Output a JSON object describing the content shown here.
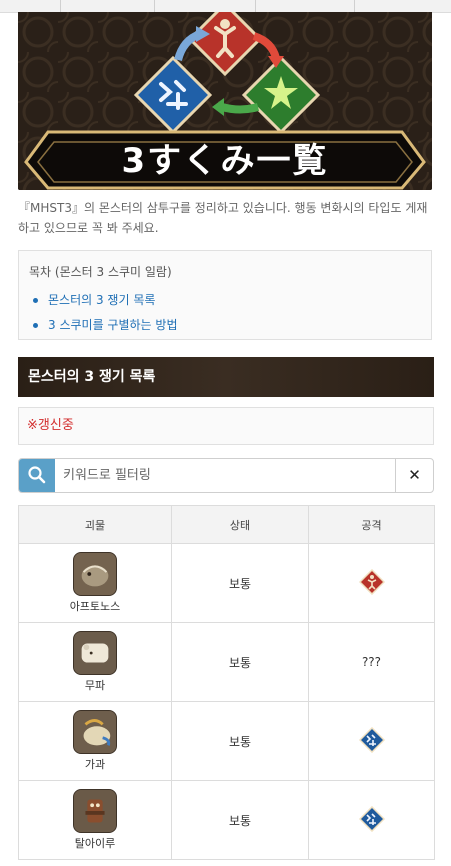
{
  "banner": {
    "title": "3すくみ一覧"
  },
  "intro_text": "『MHST3』의 몬스터의 삼투구를 정리하고 있습니다. 행동 변화시의 타입도 게재하고 있으므로 꼭 봐 주세요.",
  "toc": {
    "title": "목차 (몬스터 3 스쿠미 일람)",
    "items": [
      {
        "label": "몬스터의 3 쟁기 목록"
      },
      {
        "label": "3 스쿠미를 구별하는 방법"
      }
    ]
  },
  "section": {
    "header": "몬스터의 3 쟁기 목록",
    "notice": "※갱신중"
  },
  "filter": {
    "placeholder": "키워드로 필터링",
    "clear_label": "✕"
  },
  "table": {
    "headers": [
      "괴물",
      "상태",
      "공격"
    ],
    "rows": [
      {
        "name": "아프토노스",
        "state": "보통",
        "attack": "power",
        "attack_text": ""
      },
      {
        "name": "무파",
        "state": "보통",
        "attack": "unknown",
        "attack_text": "???"
      },
      {
        "name": "가과",
        "state": "보통",
        "attack": "technical",
        "attack_text": ""
      },
      {
        "name": "탈아이루",
        "state": "보통",
        "attack": "technical",
        "attack_text": ""
      }
    ]
  },
  "colors": {
    "power": "#c0392b",
    "speed": "#2e8b2e",
    "technical": "#2a6fb0",
    "link": "#1f6fb5",
    "notice": "#d32f2f"
  },
  "icons": {
    "search": "search-icon",
    "clear": "close-icon"
  }
}
